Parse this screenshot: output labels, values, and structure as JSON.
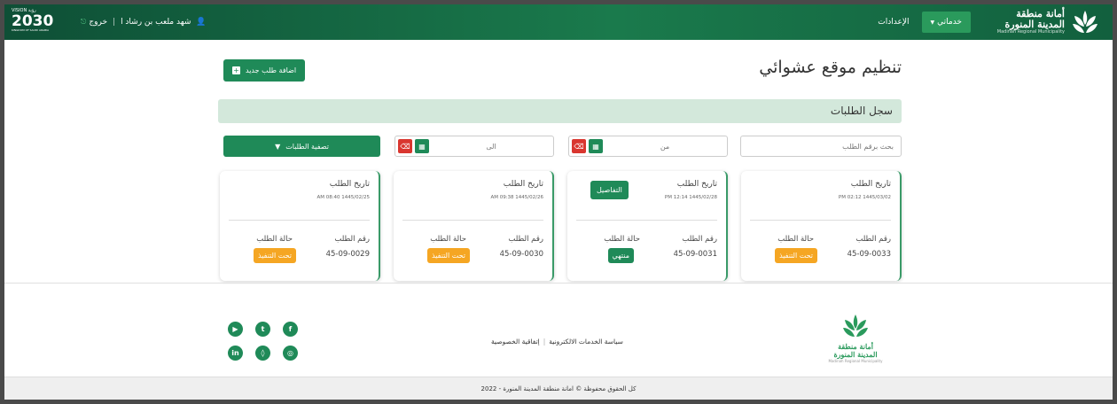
{
  "header": {
    "brand_line1": "أمانة منطقة",
    "brand_line2": "المدينة المنورة",
    "brand_en": "Madinah Regional Municipality",
    "nav": [
      {
        "label": "خدماتي",
        "icon": "caret-down-icon"
      },
      {
        "label": "الإعدادات"
      }
    ],
    "user_name": "شهد ملعب بن رشاد ا",
    "logout": "خروج",
    "vision": "2030",
    "vision_top": "VISION رؤية",
    "vision_sub": "KINGDOM OF SAUDI ARABIA"
  },
  "page": {
    "title": "تنظيم موقع عشوائي",
    "add_button": "اضافة طلب جديد",
    "section_title": "سجل الطلبات",
    "search_placeholder": "بحث برقم الطلب",
    "from_label": "من",
    "to_label": "الى",
    "filter_button": "تصفية الطلبات"
  },
  "cards": [
    {
      "date_label": "تاريخ الطلب",
      "datetime": "PM 02:12  1445/03/02",
      "number_label": "رقم الطلب",
      "number": "45-09-0033",
      "status_label": "حالة الطلب",
      "status": "تحت التنفيذ",
      "status_color": "#f5a623",
      "details": ""
    },
    {
      "date_label": "تاريخ الطلب",
      "datetime": "PM 12:14  1445/02/28",
      "number_label": "رقم الطلب",
      "number": "45-09-0031",
      "status_label": "حالة الطلب",
      "status": "منتهي",
      "status_color": "#1f8a58",
      "details": "التفاصيل"
    },
    {
      "date_label": "تاريخ الطلب",
      "datetime": "AM 09:38  1445/02/26",
      "number_label": "رقم الطلب",
      "number": "45-09-0030",
      "status_label": "حالة الطلب",
      "status": "تحت التنفيذ",
      "status_color": "#f5a623",
      "details": ""
    },
    {
      "date_label": "تاريخ الطلب",
      "datetime": "AM 08:40  1445/02/25",
      "number_label": "رقم الطلب",
      "number": "45-09-0029",
      "status_label": "حالة الطلب",
      "status": "تحت التنفيذ",
      "status_color": "#f5a623",
      "details": ""
    }
  ],
  "footer": {
    "links": [
      "سياسة الخدمات الالكترونية",
      "إتفاقية الخصوصية"
    ],
    "social": [
      "youtube-icon",
      "twitter-icon",
      "facebook-icon",
      "linkedin-icon",
      "snapchat-icon",
      "instagram-icon"
    ],
    "copyright": "كل الحقوق محفوظة © امانة منطقة المدينة المنورة - 2022"
  },
  "colors": {
    "primary": "#1f8a58",
    "warning": "#f5a623",
    "danger": "#d9362f",
    "header": "#0e4f36"
  }
}
